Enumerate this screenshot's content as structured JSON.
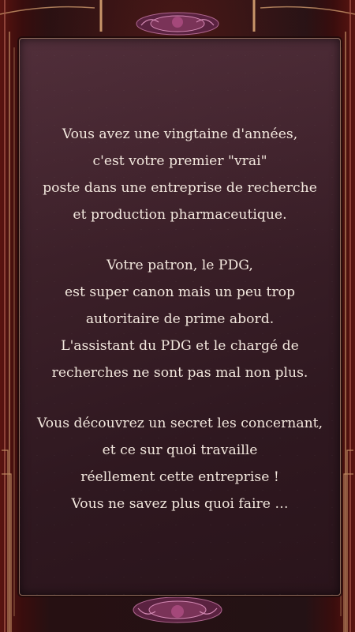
{
  "story": {
    "paragraphs": [
      {
        "lines": [
          "Vous avez une vingtaine d'années,",
          "c'est votre premier \"vrai\"",
          "poste dans une entreprise de recherche",
          "et production pharmaceutique."
        ]
      },
      {
        "lines": [
          "Votre patron, le PDG,",
          "est super canon mais un peu trop",
          "autoritaire de prime abord.",
          "L'assistant du PDG et le chargé de",
          "recherches ne sont pas mal non plus."
        ]
      },
      {
        "lines": [
          "Vous découvrez un secret les concernant,",
          "et ce sur quoi travaille",
          "réellement cette entreprise !",
          "Vous ne savez plus quoi faire …"
        ]
      }
    ]
  },
  "colors": {
    "frame_gold": "#c9966a",
    "ornament": "#8a3b63",
    "text": "#f3e8de"
  }
}
